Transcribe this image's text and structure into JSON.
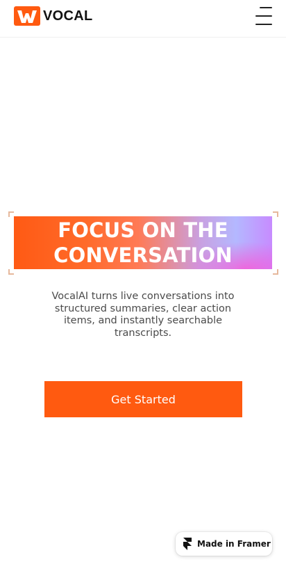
{
  "brand": {
    "name": "VOCAL",
    "accent_color": "#ff5a10"
  },
  "header": {
    "menu_icon": "hamburger-menu-icon"
  },
  "hero": {
    "headline_line1": "FOCUS ON THE",
    "headline_line2": "CONVERSATION",
    "description": "VocalAI turns live conversations into structured summaries, clear action items, and instantly searchable transcripts.",
    "gradient_colors": [
      "#ff5a14",
      "#b4b8ff",
      "#ff50d2"
    ]
  },
  "cta": {
    "label": "Get Started"
  },
  "badge": {
    "label": "Made in Framer",
    "icon": "framer-logo-icon"
  }
}
